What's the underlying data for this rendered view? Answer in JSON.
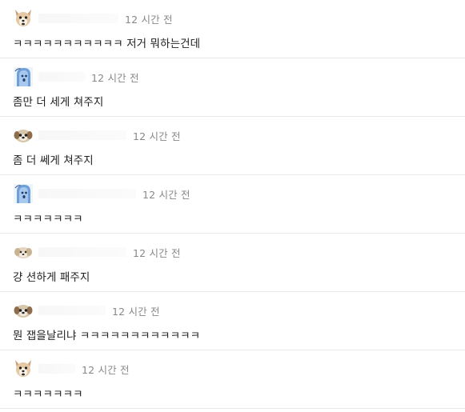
{
  "comments": [
    {
      "avatar": "chihuahua-icon",
      "time": "12 시간 전",
      "text": "ㅋㅋㅋㅋㅋㅋㅋㅋㅋㅋㅋ 저거 뭐하는건데"
    },
    {
      "avatar": "blue-ghost-icon",
      "time": "12 시간 전",
      "text": "좀만 더 세게 쳐주지"
    },
    {
      "avatar": "puppy-icon",
      "time": "12 시간 전",
      "text": "좀 더 쎄게 쳐주지"
    },
    {
      "avatar": "blue-ghost-icon",
      "time": "12 시간 전",
      "text": "ㅋㅋㅋㅋㅋㅋㅋ"
    },
    {
      "avatar": "fluffy-dog-icon",
      "time": "12 시간 전",
      "text": "걍 션하게 패주지"
    },
    {
      "avatar": "puppy-icon",
      "time": "12 시간 전",
      "text": "뭔 잽을날리냐 ㅋㅋㅋㅋㅋㅋㅋㅋㅋㅋㅋㅋ"
    },
    {
      "avatar": "chihuahua-icon",
      "time": "12 시간 전",
      "text": "ㅋㅋㅋㅋㅋㅋㅋ"
    }
  ]
}
